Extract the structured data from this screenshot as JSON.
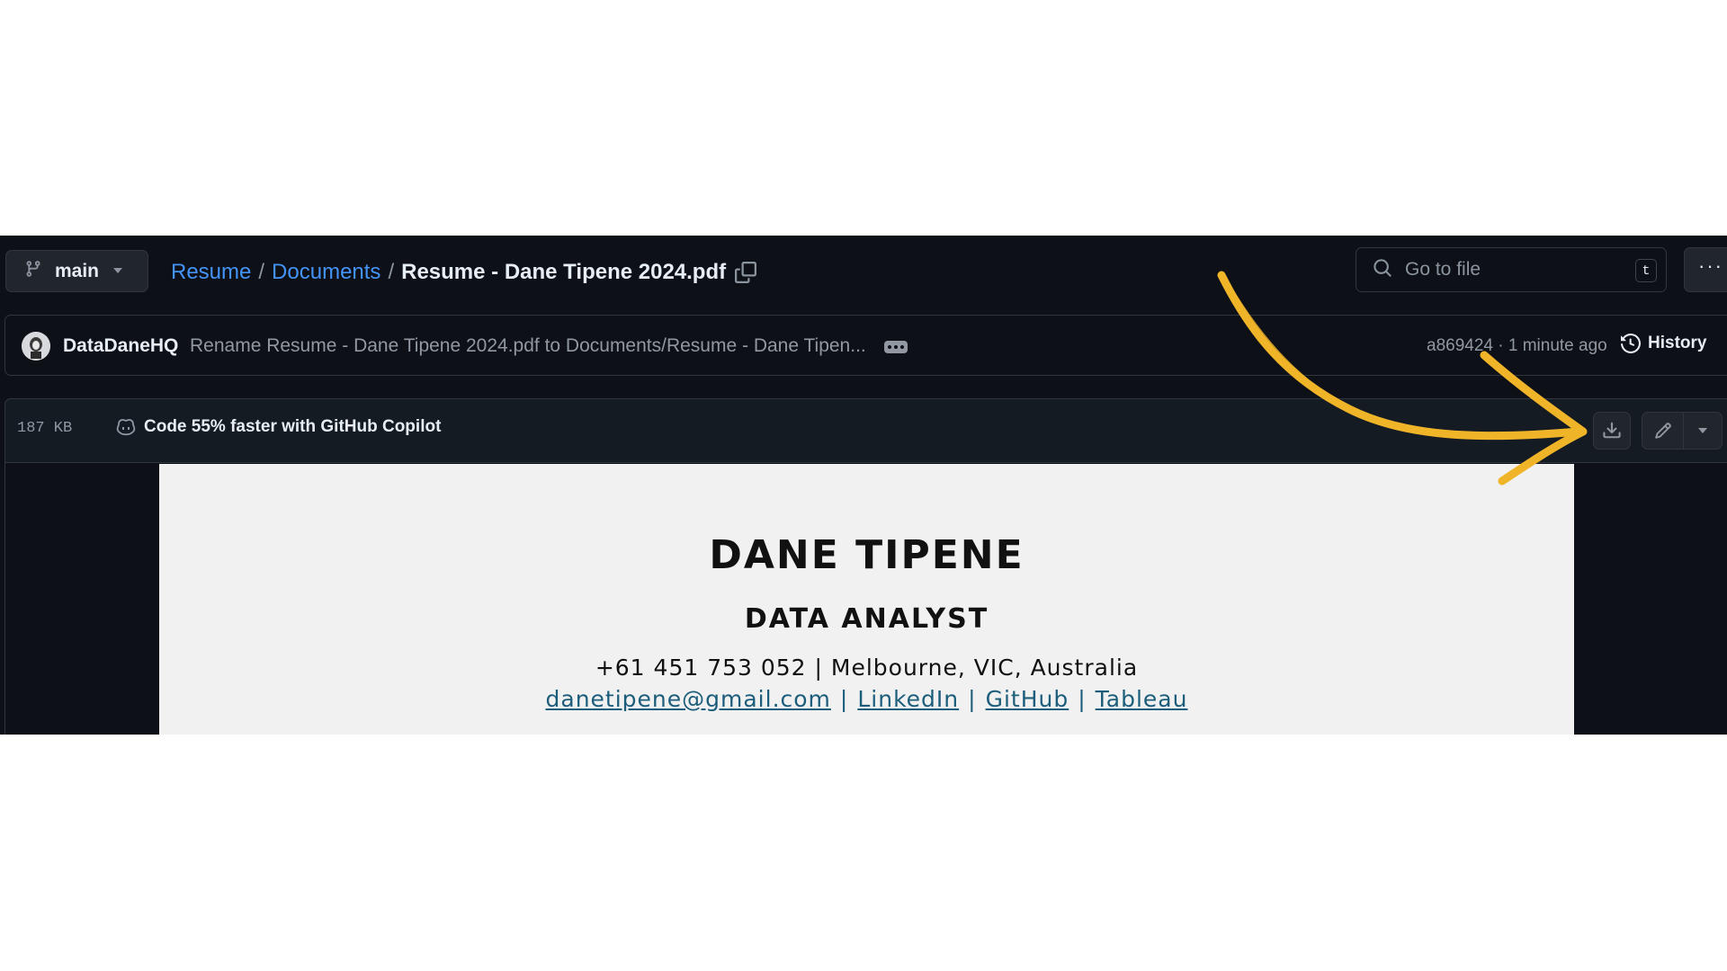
{
  "branch": {
    "name": "main"
  },
  "breadcrumb": {
    "links": [
      "Resume",
      "Documents"
    ],
    "separator": "/",
    "current": "Resume - Dane Tipene 2024.pdf"
  },
  "search": {
    "placeholder": "Go to file",
    "shortcut": "t"
  },
  "more_label": "···",
  "commit": {
    "author": "DataDaneHQ",
    "message": "Rename Resume - Dane Tipene 2024.pdf to Documents/Resume - Dane Tipen...",
    "sha": "a869424",
    "time": "1 minute ago",
    "meta": "a869424 · 1 minute ago",
    "history_label": "History"
  },
  "file": {
    "size": "187 KB",
    "copilot_label": "Code 55% faster with GitHub Copilot"
  },
  "pdf": {
    "name": "DANE TIPENE",
    "title": "DATA ANALYST",
    "contact": "+61 451 753 052 | Melbourne, VIC, Australia",
    "links": [
      "danetipene@gmail.com",
      "LinkedIn",
      "GitHub",
      "Tableau"
    ],
    "link_separator": "|"
  },
  "colors": {
    "background": "#0d1117",
    "link": "#4493f8",
    "annotation_arrow": "#f0b429",
    "pdf_link": "#1d5d7c"
  },
  "icons": [
    "git-branch-icon",
    "caret-down-icon",
    "copy-icon",
    "search-icon",
    "kebab-horizontal-icon",
    "history-icon",
    "copilot-icon",
    "download-icon",
    "pencil-icon",
    "annotation-arrow"
  ]
}
